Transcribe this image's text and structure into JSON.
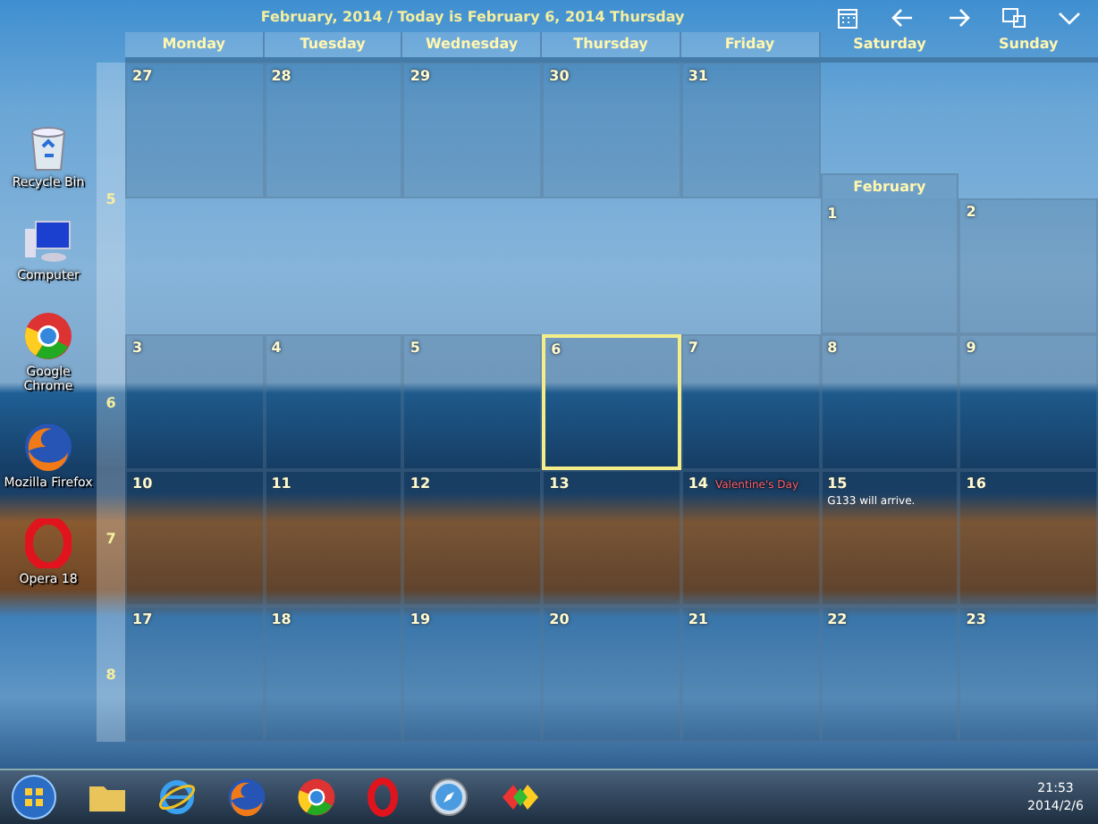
{
  "desktop_icons": [
    {
      "label": "Recycle Bin",
      "kind": "bin"
    },
    {
      "label": "Computer",
      "kind": "computer"
    },
    {
      "label": "Google Chrome",
      "kind": "chrome"
    },
    {
      "label": "Mozilla Firefox",
      "kind": "firefox"
    },
    {
      "label": "Opera 18",
      "kind": "opera"
    }
  ],
  "calendar": {
    "title": "February, 2014 / Today is February 6, 2014 Thursday",
    "weekdays": [
      "Monday",
      "Tuesday",
      "Wednesday",
      "Thursday",
      "Friday",
      "Saturday",
      "Sunday"
    ],
    "weeks": [
      {
        "number": "5",
        "rows": [
          [
            {
              "kind": "day",
              "date": "27"
            },
            {
              "kind": "day",
              "date": "28"
            },
            {
              "kind": "day",
              "date": "29"
            },
            {
              "kind": "day",
              "date": "30"
            },
            {
              "kind": "day",
              "date": "31"
            },
            {
              "kind": "blank"
            },
            {
              "kind": "blank"
            }
          ],
          [
            {
              "kind": "blank"
            },
            {
              "kind": "blank"
            },
            {
              "kind": "blank"
            },
            {
              "kind": "blank"
            },
            {
              "kind": "blank"
            },
            {
              "kind": "day",
              "date": "1",
              "month_label": "February"
            },
            {
              "kind": "day",
              "date": "2"
            }
          ]
        ]
      },
      {
        "number": "6",
        "rows": [
          [
            {
              "kind": "day",
              "date": "3"
            },
            {
              "kind": "day",
              "date": "4"
            },
            {
              "kind": "day",
              "date": "5"
            },
            {
              "kind": "day",
              "date": "6",
              "selected": true
            },
            {
              "kind": "day",
              "date": "7"
            },
            {
              "kind": "day",
              "date": "8"
            },
            {
              "kind": "day",
              "date": "9"
            }
          ]
        ]
      },
      {
        "number": "7",
        "rows": [
          [
            {
              "kind": "day",
              "date": "10"
            },
            {
              "kind": "day",
              "date": "11"
            },
            {
              "kind": "day",
              "date": "12"
            },
            {
              "kind": "day",
              "date": "13"
            },
            {
              "kind": "day",
              "date": "14",
              "holiday": "Valentine's Day"
            },
            {
              "kind": "day",
              "date": "15",
              "note": "G133 will arrive."
            },
            {
              "kind": "day",
              "date": "16"
            }
          ]
        ]
      },
      {
        "number": "8",
        "rows": [
          [
            {
              "kind": "day",
              "date": "17"
            },
            {
              "kind": "day",
              "date": "18"
            },
            {
              "kind": "day",
              "date": "19"
            },
            {
              "kind": "day",
              "date": "20"
            },
            {
              "kind": "day",
              "date": "21"
            },
            {
              "kind": "day",
              "date": "22"
            },
            {
              "kind": "day",
              "date": "23"
            }
          ]
        ]
      }
    ]
  },
  "taskbar": {
    "time": "21:53",
    "date": "2014/2/6"
  }
}
